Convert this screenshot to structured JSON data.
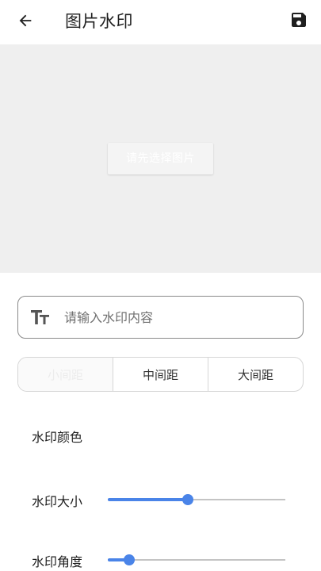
{
  "header": {
    "title": "图片水印",
    "back_icon": "arrow-left-icon",
    "save_icon": "floppy-disk-icon"
  },
  "preview": {
    "choose_image_label": "请先选择图片",
    "background_color": "#efefef"
  },
  "watermark_text": {
    "icon": "text-size-icon",
    "placeholder": "请输入水印内容",
    "value": ""
  },
  "spacing": {
    "options": [
      "小间距",
      "中间距",
      "大间距"
    ],
    "selected_index": 0
  },
  "color_setting": {
    "label": "水印颜色"
  },
  "size_setting": {
    "label": "水印大小",
    "value_fraction": 0.45
  },
  "angle_setting": {
    "label": "水印角度",
    "value_fraction": 0.12
  },
  "colors": {
    "accent": "#4a84e8",
    "track": "#c4c4c4"
  }
}
